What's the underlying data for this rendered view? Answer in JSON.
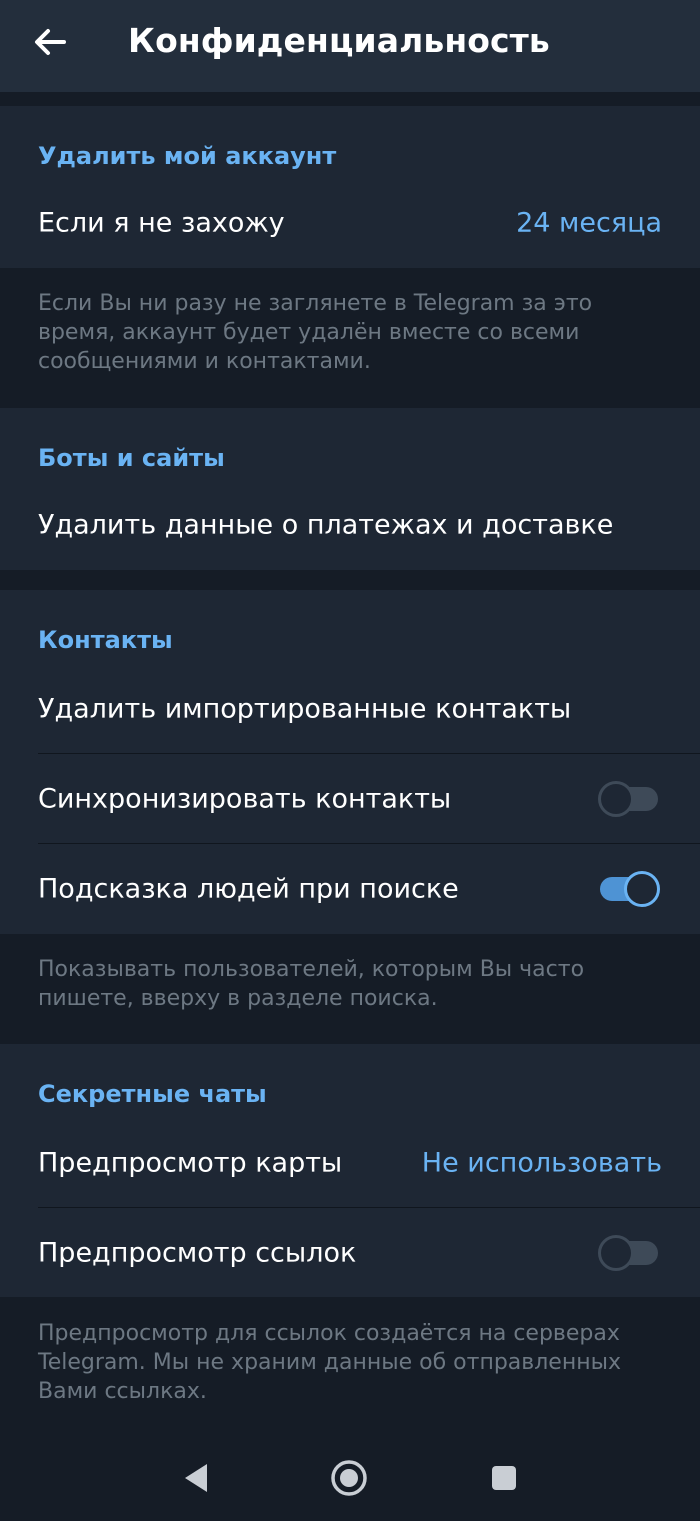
{
  "header": {
    "title": "Конфиденциальность",
    "back_icon": "arrow-left-icon"
  },
  "delete_account": {
    "title": "Удалить мой аккаунт",
    "row_label": "Если я не захожу",
    "row_value": "24 месяца",
    "footnote": "Если Вы ни разу не заглянете в Telegram за это время, аккаунт будет удалён вместе со всеми сообщениями и контактами."
  },
  "bots": {
    "title": "Боты и сайты",
    "row_label": "Удалить данные о платежах и доставке"
  },
  "contacts": {
    "title": "Контакты",
    "rows": [
      {
        "label": "Удалить импортированные контакты"
      },
      {
        "label": "Синхронизировать контакты",
        "toggle": false
      },
      {
        "label": "Подсказка людей при поиске",
        "toggle": true
      }
    ],
    "footnote": "Показывать пользователей, которым Вы часто пишете, вверху в разделе поиска."
  },
  "secret_chats": {
    "title": "Секретные чаты",
    "rows": [
      {
        "label": "Предпросмотр карты",
        "value": "Не использовать"
      },
      {
        "label": "Предпросмотр ссылок",
        "toggle": false
      }
    ],
    "footnote": "Предпросмотр для ссылок создаётся на серверах Telegram. Мы не храним данные об отправленных Вами ссылках."
  },
  "navbar": {
    "back": "nav-back-icon",
    "home": "nav-home-icon",
    "recents": "nav-recents-icon"
  },
  "colors": {
    "accent": "#6ab3f3",
    "header_bg": "#232e3c",
    "section_bg": "#1e2734",
    "page_bg": "#151c26"
  }
}
